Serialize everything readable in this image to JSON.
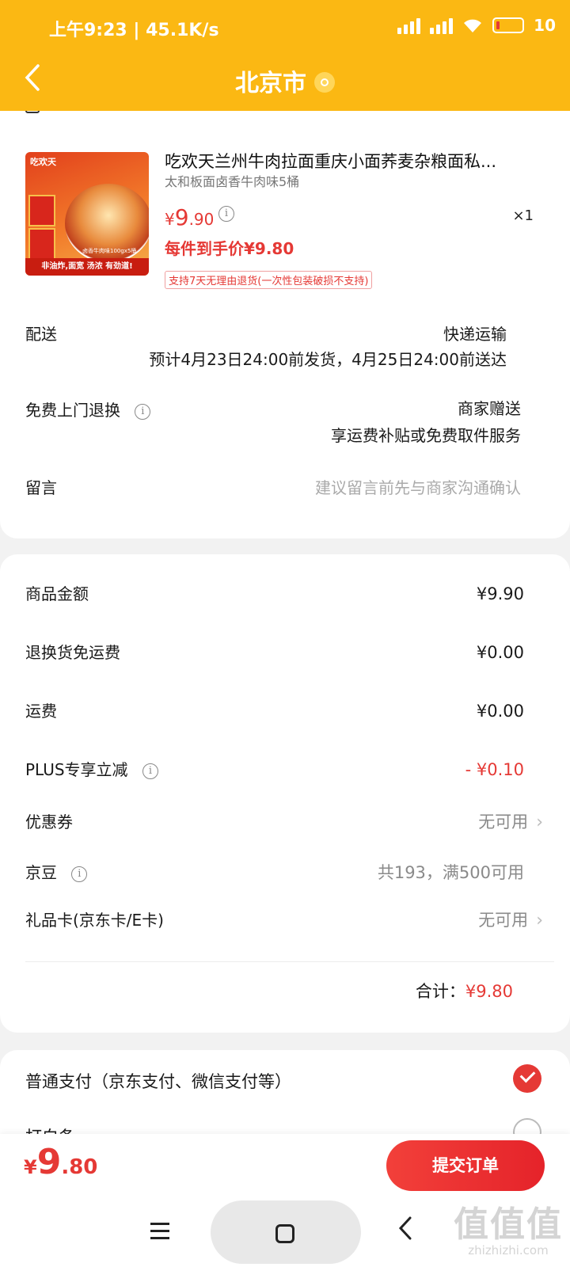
{
  "status_bar": {
    "time": "上午9:23",
    "speed": "45.1K/s",
    "battery": "10"
  },
  "header": {
    "title": "北京市",
    "back_icon": "chevron-left-icon",
    "location_icon": "location-pin-icon"
  },
  "product": {
    "title": "吃欢天兰州牛肉拉面重庆小面荞麦杂粮面私...",
    "spec": "太和板面卤香牛肉味5桶",
    "price_symbol": "¥",
    "price_int": "9",
    "price_dec": ".90",
    "quantity": "×1",
    "hand_price": "每件到手价¥9.80",
    "return_badge": "支持7天无理由退货(一次性包装破损不支持)",
    "image": {
      "brand": "吃欢天",
      "caption": "卤香牛肉味100gx5桶",
      "banner": "非油炸,面宽 汤浓 有劲道!"
    }
  },
  "delivery": {
    "label": "配送",
    "method": "快递运输",
    "estimate": "预计4月23日24:00前发货，4月25日24:00前送达"
  },
  "return_service": {
    "label": "免费上门退换",
    "value": "商家赠送",
    "sub": "享运费补贴或免费取件服务"
  },
  "message": {
    "label": "留言",
    "placeholder": "建议留言前先与商家沟通确认"
  },
  "summary": {
    "rows": [
      {
        "label": "商品金额",
        "value": "¥9.90"
      },
      {
        "label": "退换货免运费",
        "value": "¥0.00"
      },
      {
        "label": "运费",
        "value": "¥0.00"
      },
      {
        "label": "PLUS专享立减",
        "value": "- ¥0.10"
      },
      {
        "label": "优惠券",
        "value": "无可用"
      },
      {
        "label": "京豆",
        "value": "共193，满500可用"
      },
      {
        "label": "礼品卡(京东卡/E卡)",
        "value": "无可用"
      }
    ],
    "total_label": "合计：",
    "total_value": "¥9.80"
  },
  "payment": {
    "option1": "普通支付（京东支付、微信支付等）",
    "option2": "打白条"
  },
  "bottom": {
    "currency": "¥",
    "price_int": "9",
    "price_dec": ".80",
    "submit_label": "提交订单"
  },
  "watermark": {
    "main": "值值值",
    "sub": "zhizhizhi.com"
  },
  "colors": {
    "header_bg": "#fbb813",
    "accent_red": "#e53935"
  }
}
